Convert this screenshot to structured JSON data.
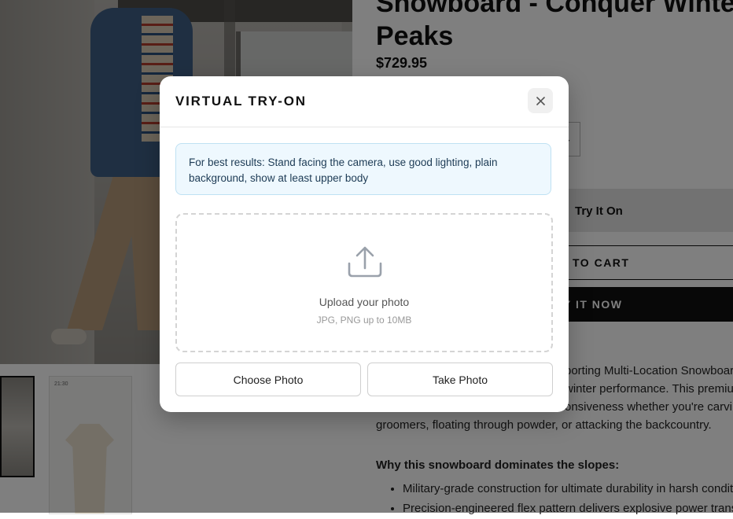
{
  "product": {
    "title_line1": "Snowboard - Conquer Winter",
    "title_line2": "Peaks",
    "price": "$729.95",
    "variant_chevron": "⌄",
    "try_on_label": "Try It On",
    "add_to_cart_label": "TO CART",
    "buy_now_label": "Y IT NOW",
    "description_lines": [
      "porting Multi-Location Snowboard",
      "winter performance. This premium",
      "onsiveness whether you're carving",
      "groomers, floating through powder, or attacking the backcountry."
    ],
    "why_heading": "Why this snowboard dominates the slopes:",
    "bullets": [
      "Military-grade construction for ultimate durability in harsh conditions",
      "Precision-engineered flex pattern delivers explosive power transfer"
    ],
    "thumbnail_status": "21:30"
  },
  "modal": {
    "title": "VIRTUAL TRY-ON",
    "close_icon": "close-icon",
    "tip": "For best results: Stand facing the camera, use good lighting, plain background, show at least upper body",
    "upload_label": "Upload your photo",
    "upload_hint": "JPG, PNG up to 10MB",
    "upload_icon": "upload-icon",
    "choose_photo_label": "Choose Photo",
    "take_photo_label": "Take Photo"
  },
  "colors": {
    "overlay": "rgba(0,0,0,0.5)",
    "tip_background": "#eef8fe",
    "tip_border": "#bfe1f3"
  }
}
